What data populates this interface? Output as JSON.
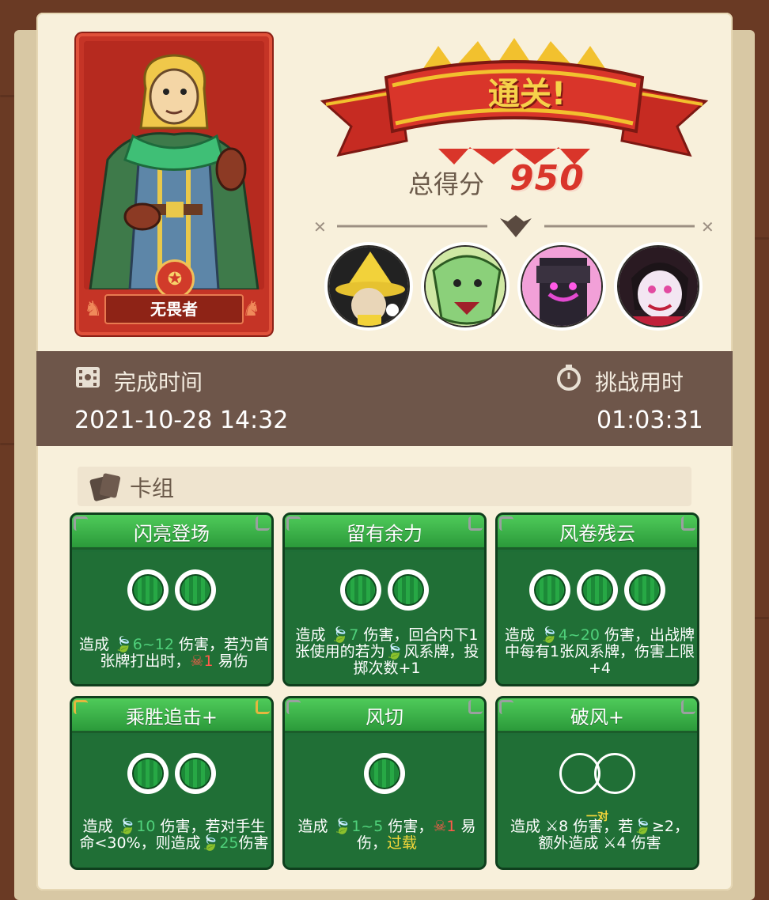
{
  "hero": {
    "name": "无畏者"
  },
  "result": {
    "banner": "通关!",
    "score_label": "总得分",
    "score_value": "950"
  },
  "enemies": [
    {
      "name": "yellow-hat-wizard"
    },
    {
      "name": "green-dragon"
    },
    {
      "name": "dark-knight"
    },
    {
      "name": "vampire"
    }
  ],
  "stats": {
    "completion_label": "完成时间",
    "completion_value": "2021-10-28 14:32",
    "duration_label": "挑战用时",
    "duration_value": "01:03:31"
  },
  "deck": {
    "title": "卡组",
    "cards": [
      {
        "title": "闪亮登场",
        "orbs": 2,
        "text_parts": [
          "造成 ",
          "6~12",
          " 伤害，若为首张牌打出时，",
          "1",
          " 易伤"
        ]
      },
      {
        "title": "留有余力",
        "orbs": 2,
        "text_parts": [
          "造成 ",
          "7",
          " 伤害，回合内下1张使用的若为",
          "风系牌，投掷次数+1"
        ]
      },
      {
        "title": "风卷残云",
        "orbs": 3,
        "text_parts": [
          "造成 ",
          "4~20",
          " 伤害，出战牌中每有1张风系牌，伤害上限+4"
        ]
      },
      {
        "title": "乘胜追击+",
        "orbs": 2,
        "text_parts": [
          "造成 ",
          "10",
          " 伤害，若对手生命<30%，则造成",
          "25",
          "伤害"
        ]
      },
      {
        "title": "风切",
        "orbs": 1,
        "text_parts": [
          "造成 ",
          "1~5",
          " 伤害，",
          "1",
          " 易伤，",
          "过载"
        ]
      },
      {
        "title": "破风+",
        "orbs": 0,
        "pair_label": "一对",
        "text_parts": [
          "造成 ",
          "8",
          " 伤害，若",
          "≥2，额外造成 ",
          "4",
          " 伤害"
        ]
      }
    ]
  }
}
